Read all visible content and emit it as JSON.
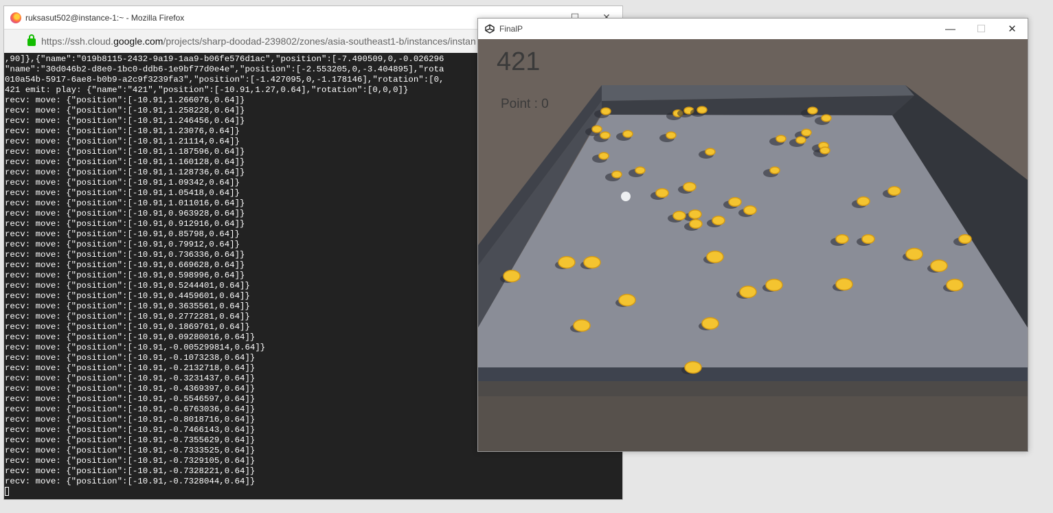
{
  "firefox": {
    "title": "ruksasut502@instance-1:~ - Mozilla Firefox",
    "url_prefix": "https://ssh.cloud.",
    "url_host": "google.com",
    "url_path": "/projects/sharp-doodad-239802/zones/asia-southeast1-b/instances/instan"
  },
  "terminal": {
    "lines": [
      ",90]},{\"name\":\"019b8115-2432-9a19-1aa9-b06fe576d1ac\",\"position\":[-7.490509,0,-0.026296",
      "\"name\":\"30d046b2-d8e0-1bc0-ddb6-1e9bf77d0e4e\",\"position\":[-2.553205,0,-3.404895],\"rota",
      "010a54b-5917-6ae8-b0b9-a2c9f3239fa3\",\"position\":[-1.427095,0,-1.178146],\"rotation\":[0,",
      "421 emit: play: {\"name\":\"421\",\"position\":[-10.91,1.27,0.64],\"rotation\":[0,0,0]}",
      "recv: move: {\"position\":[-10.91,1.266076,0.64]}",
      "recv: move: {\"position\":[-10.91,1.258228,0.64]}",
      "recv: move: {\"position\":[-10.91,1.246456,0.64]}",
      "recv: move: {\"position\":[-10.91,1.23076,0.64]}",
      "recv: move: {\"position\":[-10.91,1.21114,0.64]}",
      "recv: move: {\"position\":[-10.91,1.187596,0.64]}",
      "recv: move: {\"position\":[-10.91,1.160128,0.64]}",
      "recv: move: {\"position\":[-10.91,1.128736,0.64]}",
      "recv: move: {\"position\":[-10.91,1.09342,0.64]}",
      "recv: move: {\"position\":[-10.91,1.05418,0.64]}",
      "recv: move: {\"position\":[-10.91,1.011016,0.64]}",
      "recv: move: {\"position\":[-10.91,0.963928,0.64]}",
      "recv: move: {\"position\":[-10.91,0.912916,0.64]}",
      "recv: move: {\"position\":[-10.91,0.85798,0.64]}",
      "recv: move: {\"position\":[-10.91,0.79912,0.64]}",
      "recv: move: {\"position\":[-10.91,0.736336,0.64]}",
      "recv: move: {\"position\":[-10.91,0.669628,0.64]}",
      "recv: move: {\"position\":[-10.91,0.598996,0.64]}",
      "recv: move: {\"position\":[-10.91,0.5244401,0.64]}",
      "recv: move: {\"position\":[-10.91,0.4459601,0.64]}",
      "recv: move: {\"position\":[-10.91,0.3635561,0.64]}",
      "recv: move: {\"position\":[-10.91,0.2772281,0.64]}",
      "recv: move: {\"position\":[-10.91,0.1869761,0.64]}",
      "recv: move: {\"position\":[-10.91,0.09280016,0.64]}",
      "recv: move: {\"position\":[-10.91,-0.005299814,0.64]}",
      "recv: move: {\"position\":[-10.91,-0.1073238,0.64]}",
      "recv: move: {\"position\":[-10.91,-0.2132718,0.64]}",
      "recv: move: {\"position\":[-10.91,-0.3231437,0.64]}",
      "recv: move: {\"position\":[-10.91,-0.4369397,0.64]}",
      "recv: move: {\"position\":[-10.91,-0.5546597,0.64]}",
      "recv: move: {\"position\":[-10.91,-0.6763036,0.64]}",
      "recv: move: {\"position\":[-10.91,-0.8018716,0.64]}",
      "recv: move: {\"position\":[-10.91,-0.7466143,0.64]}",
      "recv: move: {\"position\":[-10.91,-0.7355629,0.64]}",
      "recv: move: {\"position\":[-10.91,-0.7333525,0.64]}",
      "recv: move: {\"position\":[-10.91,-0.7329105,0.64]}",
      "recv: move: {\"position\":[-10.91,-0.7328221,0.64]}",
      "recv: move: {\"position\":[-10.91,-0.7328044,0.64]}"
    ]
  },
  "unity": {
    "title": "FinalP",
    "score": "421",
    "points": "Point : 0",
    "coin_color": "#f4c430",
    "floor_color": "#8a8d97",
    "wall_color": "#4a4d55",
    "background_color": "#6b625c"
  },
  "icons": {
    "browser": "firefox-icon",
    "secure": "lock-icon",
    "app": "unity-icon",
    "minimize": "minimize-icon",
    "maximize": "maximize-icon",
    "close": "close-icon"
  }
}
